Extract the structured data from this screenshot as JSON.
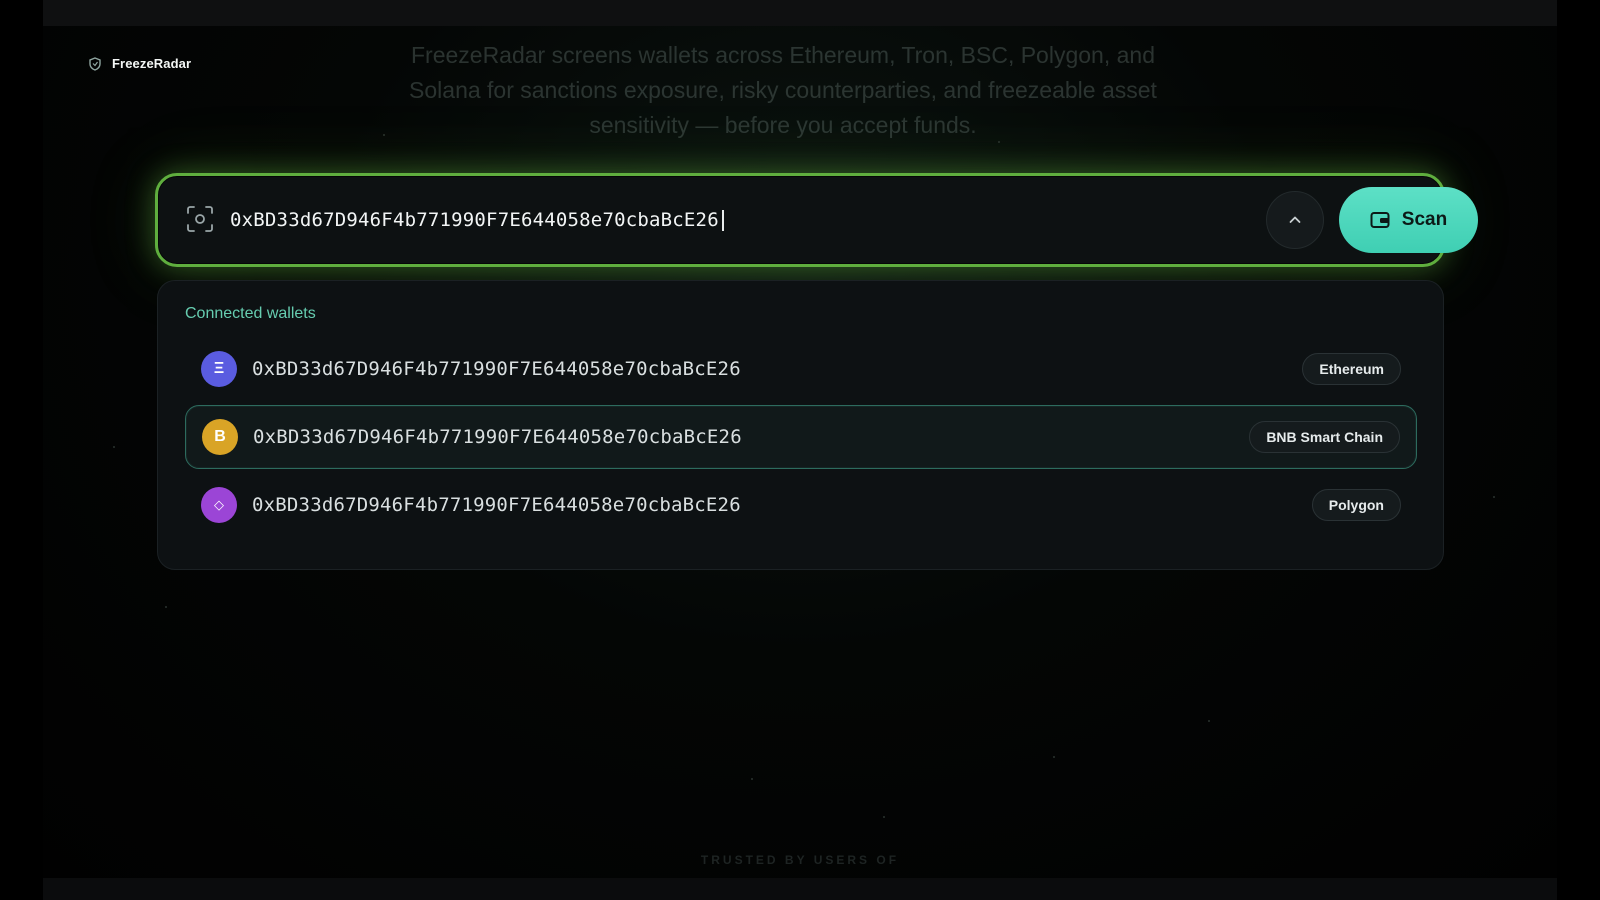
{
  "brand": {
    "name": "FreezeRadar"
  },
  "hero": {
    "description": "FreezeRadar screens wallets across Ethereum, Tron, BSC, Polygon, and Solana for sanctions exposure, risky counterparties, and freezeable asset sensitivity — before you accept funds."
  },
  "search": {
    "value": "0xBD33d67D946F4b771990F7E644058e70cbaBcE26",
    "scan_label": "Scan",
    "icons": {
      "leading": "scan-frame-icon",
      "collapse": "chevron-up-icon",
      "scan": "wallet-icon"
    }
  },
  "dropdown": {
    "title": "Connected wallets",
    "wallets": [
      {
        "glyph": "Ξ",
        "address": "0xBD33d67D946F4b771990F7E644058e70cbaBcE26",
        "chain": "Ethereum",
        "color": "#5a5ce0",
        "selected": false
      },
      {
        "glyph": "B",
        "address": "0xBD33d67D946F4b771990F7E644058e70cbaBcE26",
        "chain": "BNB Smart Chain",
        "color": "#d9a426",
        "selected": true
      },
      {
        "glyph": "◇",
        "address": "0xBD33d67D946F4b771990F7E644058e70cbaBcE26",
        "chain": "Polygon",
        "color": "#9b45d6",
        "selected": false
      }
    ]
  },
  "footer": {
    "trusted_label": "TRUSTED BY USERS OF"
  },
  "colors": {
    "accent": "#3fcfb3",
    "glow": "#5fae3e",
    "label": "#66cdb0"
  }
}
